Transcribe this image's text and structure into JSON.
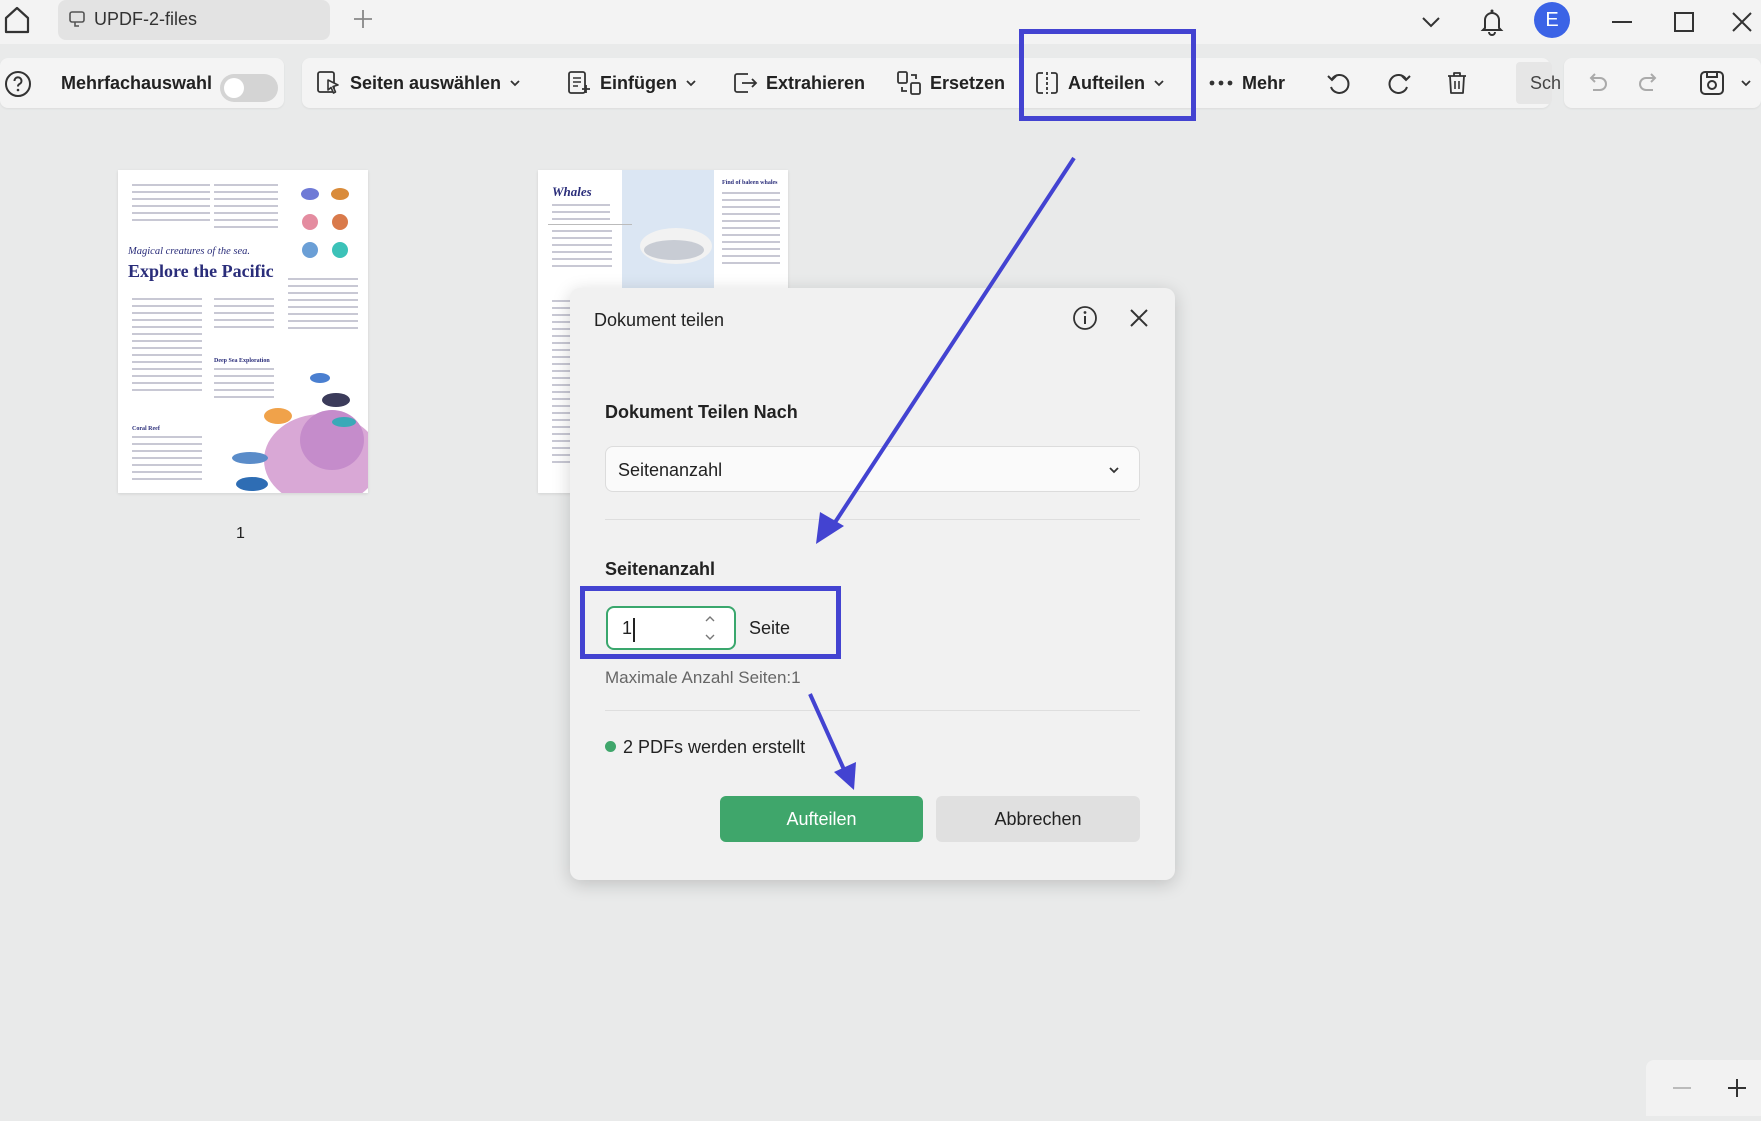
{
  "titlebar": {
    "tab_title": "UPDF-2-files",
    "avatar_initial": "E",
    "avatar_color": "#3b63e6"
  },
  "toolbar": {
    "multi_select_label": "Mehrfachauswahl",
    "select_pages_label": "Seiten auswählen",
    "insert_label": "Einfügen",
    "extract_label": "Extrahieren",
    "replace_label": "Ersetzen",
    "split_label": "Aufteilen",
    "more_label": "Mehr",
    "truncated_label": "Sch"
  },
  "thumbnails": [
    {
      "page_number": "1",
      "subtitle": "Magical creatures of the sea.",
      "title": "Explore the Pacific",
      "section_deep_sea": "Deep Sea Exploration",
      "section_coral_reef": "Coral Reef"
    },
    {
      "title": "Whales",
      "side_heading": "Find of baleen whales"
    }
  ],
  "dialog": {
    "title": "Dokument teilen",
    "split_by_label": "Dokument Teilen Nach",
    "split_by_value": "Seitenanzahl",
    "page_count_label": "Seitenanzahl",
    "page_count_value": "1",
    "page_unit": "Seite",
    "max_pages_text": "Maximale Anzahl Seiten:1",
    "result_text": "2 PDFs werden erstellt",
    "confirm_label": "Aufteilen",
    "cancel_label": "Abbrechen"
  },
  "colors": {
    "accent_green": "#3fa66b",
    "highlight_blue": "#4343d1"
  }
}
